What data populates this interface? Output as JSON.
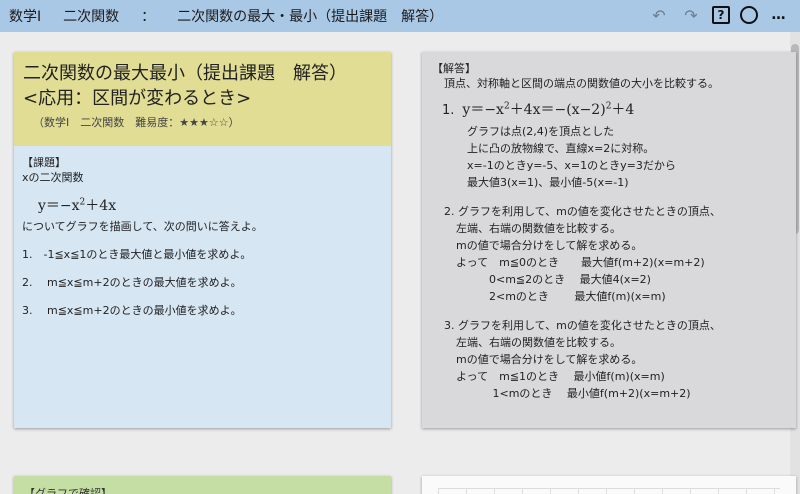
{
  "header": {
    "breadcrumb": [
      "数学Ⅰ",
      "二次関数",
      "：",
      "二次関数の最大・最小（提出課題　解答）"
    ],
    "tools": {
      "undo_icon": "↶",
      "redo_icon": "↷",
      "help_label": "?",
      "more_label": "…"
    }
  },
  "problem": {
    "title_line1": "二次関数の最大最小（提出課題　解答）",
    "title_line2": "<応用：区間が変わるとき>",
    "subtitle": "（数学Ⅰ　二次関数　難易度：★★★☆☆）",
    "section_label": "【課題】",
    "intro": "xの二次関数",
    "formula_base": "y＝−x",
    "formula_exp": "2",
    "formula_rest": "＋4x",
    "instruction": "についてグラフを描画して、次の問いに答えよ。",
    "questions": [
      "1.　-1≦x≦1のとき最大値と最小値を求めよ。",
      "2.　 m≦x≦m+2のときの最大値を求めよ。",
      "3.　 m≦x≦m+2のときの最小値を求めよ。"
    ]
  },
  "answer": {
    "section_label": "【解答】",
    "intro": "頂点、対称軸と区間の端点の関数値の大小を比較する。",
    "a1_num": "1.",
    "a1_formula_a": "y＝−x",
    "a1_exp1": "2",
    "a1_formula_b": "＋4x＝−(x−2)",
    "a1_exp2": "2",
    "a1_formula_c": "＋4",
    "a1_lines": [
      "グラフは点(2,4)を頂点とした",
      "上に凸の放物線で、直線x=2に対称。",
      "x=-1のときy=-5、x=1のときy=3だから",
      "最大値3(x=1)、最小値-5(x=-1)"
    ],
    "a2_lines": [
      "2.  グラフを利用して、mの値を変化させたときの頂点、",
      "左端、右端の関数値を比較する。",
      "mの値で場合分けをして解を求める。"
    ],
    "a2_cases": [
      "よって　m≦0のとき　　最大値f(m+2)(x=m+2)",
      "　　　0<m≦2のとき　 最大値4(x=2)",
      "　　　2<mのとき　　 最大値f(m)(x=m)"
    ],
    "a3_lines": [
      "3.  グラフを利用して、mの値を変化させたときの頂点、",
      "左端、右端の関数値を比較する。",
      "mの値で場合分けをして解を求める。"
    ],
    "a3_cases": [
      "よって　m≦1のとき　 最小値f(m)(x=m)",
      "　　　 1<mのとき　 最小値f(m+2)(x=m+2)"
    ]
  },
  "bottom": {
    "graph_label": "【グラフで確認】"
  }
}
